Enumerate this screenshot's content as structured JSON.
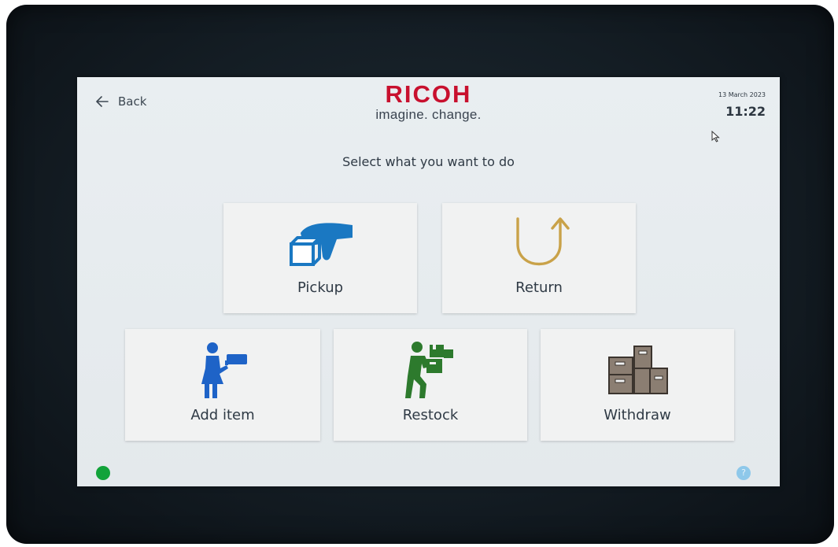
{
  "header": {
    "back_label": "Back",
    "brand": "RICOH",
    "tagline": "imagine. change.",
    "date": "13 March 2023",
    "time": "11:22"
  },
  "main": {
    "prompt": "Select what you want to do",
    "tiles": [
      {
        "label": "Pickup",
        "icon": "hand-holding-box-icon"
      },
      {
        "label": "Return",
        "icon": "u-turn-arrow-icon"
      },
      {
        "label": "Add item",
        "icon": "person-with-sign-icon"
      },
      {
        "label": "Restock",
        "icon": "person-carrying-boxes-icon"
      },
      {
        "label": "Withdraw",
        "icon": "stacked-boxes-icon"
      }
    ]
  },
  "footer": {
    "status_color": "#12a33a",
    "help_label": "?"
  },
  "colors": {
    "brand_red": "#c8102e",
    "pickup_blue": "#1a78c2",
    "return_gold": "#c9a249",
    "add_item_blue": "#1e63c7",
    "restock_green": "#2d7a2d",
    "withdraw_taupe": "#8b7e72"
  }
}
